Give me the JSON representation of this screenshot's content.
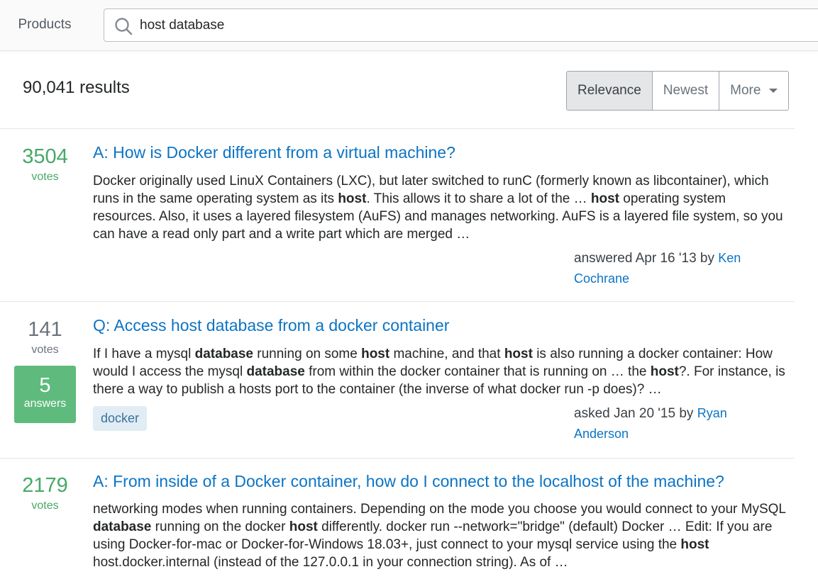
{
  "header": {
    "products_label": "Products",
    "search_value": "host database"
  },
  "results_count": "90,041 results",
  "sort": {
    "relevance": "Relevance",
    "newest": "Newest",
    "more": "More"
  },
  "results": [
    {
      "votes": "3504",
      "votes_label": "votes",
      "title": "A: How is Docker different from a virtual machine?",
      "excerpt_parts": [
        "Docker originally used LinuX Containers (LXC), but later switched to runC (formerly known as libcontainer), which runs in the same operating system as its ",
        "host",
        ". This allows it to share a lot of the … ",
        "host",
        " operating system resources. Also, it uses a layered filesystem (AuFS) and manages networking. AuFS is a layered file system, so you can have a read only part and a write part which are merged …"
      ],
      "meta_prefix": "answered Apr 16 '13 by ",
      "user": "Ken Cochrane"
    },
    {
      "votes": "141",
      "votes_label": "votes",
      "answers": "5",
      "answers_label": "answers",
      "title": "Q: Access host database from a docker container",
      "excerpt_parts": [
        "If I have a mysql ",
        "database",
        " running on some ",
        "host",
        " machine, and that ",
        "host",
        " is also running a docker container: How would I access the mysql ",
        "database",
        " from within the docker container that is running on … the ",
        "host",
        "?. For instance, is there a way to publish a hosts port to the container (the inverse of what docker run -p does)? …"
      ],
      "tag": "docker",
      "meta_prefix": "asked Jan 20 '15 by ",
      "user": "Ryan Anderson"
    },
    {
      "votes": "2179",
      "votes_label": "votes",
      "title": "A: From inside of a Docker container, how do I connect to the localhost of the machine?",
      "excerpt_parts": [
        "networking modes when running containers. Depending on the mode you choose you would connect to your MySQL ",
        "database",
        " running on the docker ",
        "host",
        " differently. docker run --network=\"bridge\" (default) Docker … Edit: If you are using Docker-for-mac or Docker-for-Windows 18.03+, just connect to your mysql service using the ",
        "host",
        " host.docker.internal (instead of the 127.0.0.1 in your connection string). As of …"
      ]
    }
  ]
}
